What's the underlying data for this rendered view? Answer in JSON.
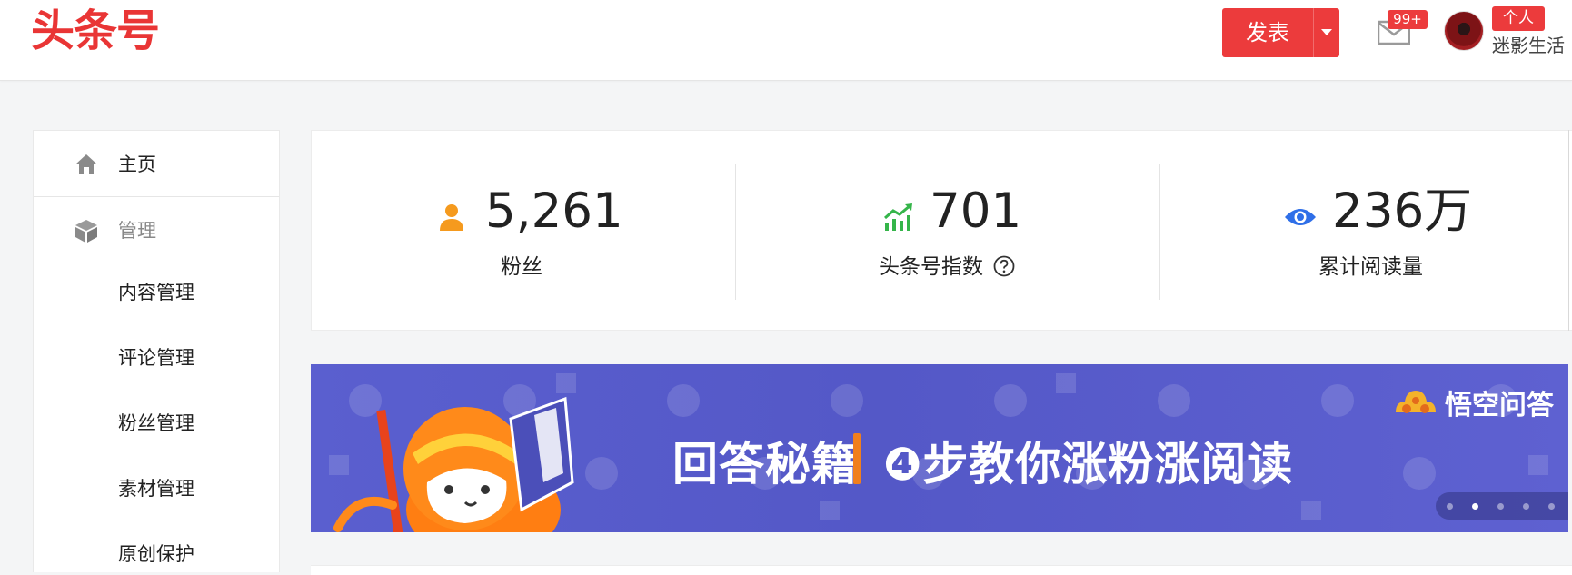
{
  "header": {
    "logo_text": "头条号",
    "publish_label": "发表",
    "mail_badge": "99+",
    "user_tag": "个人",
    "username": "迷影生活"
  },
  "sidebar": {
    "home_label": "主页",
    "manage_label": "管理",
    "items": [
      {
        "label": "内容管理"
      },
      {
        "label": "评论管理"
      },
      {
        "label": "粉丝管理"
      },
      {
        "label": "素材管理"
      },
      {
        "label": "原创保护"
      }
    ]
  },
  "stats": [
    {
      "value": "5,261",
      "label": "粉丝",
      "icon": "user-icon",
      "color": "#f59a1e"
    },
    {
      "value": "701",
      "label": "头条号指数",
      "icon": "trend-icon",
      "color": "#35b54a"
    },
    {
      "value": "236万",
      "label": "累计阅读量",
      "icon": "eye-icon",
      "color": "#2f6fe8"
    }
  ],
  "banner": {
    "headline_left": "回答秘籍",
    "headline_right": "❹步教你涨粉涨阅读",
    "brand": "悟空问答",
    "slide_count": 5,
    "active_slide": 2
  },
  "colors": {
    "brand_red": "#ec3b3c",
    "banner_bg": "#5a5fcf",
    "accent_orange": "#f07f1d"
  }
}
